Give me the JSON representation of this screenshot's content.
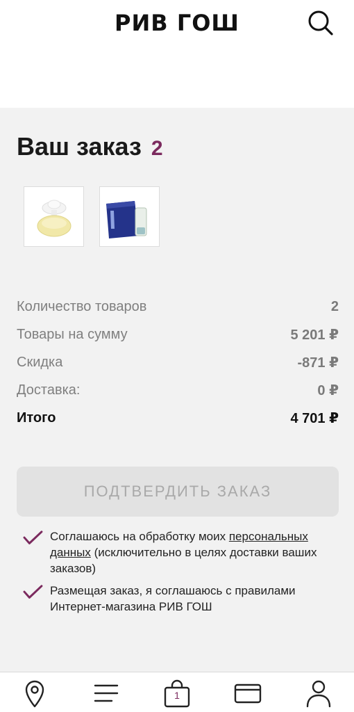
{
  "header": {
    "logo_text": "РИВ ГОШ",
    "search_icon": "search-icon"
  },
  "order": {
    "title": "Ваш заказ",
    "count": "2",
    "thumbnails": [
      {
        "icon": "perfume-bottle-image"
      },
      {
        "icon": "cosmetic-bag-image"
      }
    ]
  },
  "summary": {
    "rows": [
      {
        "label": "Количество товаров",
        "value": "2"
      },
      {
        "label": "Товары на сумму",
        "value": "5 201 ₽"
      },
      {
        "label": "Скидка",
        "value": "-871 ₽"
      },
      {
        "label": "Доставка:",
        "value": "0 ₽"
      }
    ],
    "total_label": "Итого",
    "total_value": "4 701 ₽"
  },
  "confirm_button": {
    "label": "ПОДТВЕРДИТЬ ЗАКАЗ"
  },
  "consents": [
    {
      "text_before": "Соглашаюсь на обработку моих ",
      "link_text": "персональных данных",
      "text_after": " (исключительно в целях доставки ваших заказов)"
    },
    {
      "text": "Размещая заказ, я соглашаюсь с правилами Интернет-магазина РИВ ГОШ"
    }
  ],
  "bottom_nav": {
    "items": [
      "location-pin-icon",
      "menu-icon",
      "cart-icon",
      "card-icon",
      "profile-icon"
    ],
    "cart_count": "1"
  },
  "colors": {
    "accent": "#7b2a5e",
    "background": "#f2f2f2",
    "button_disabled": "#e2e2e2"
  }
}
